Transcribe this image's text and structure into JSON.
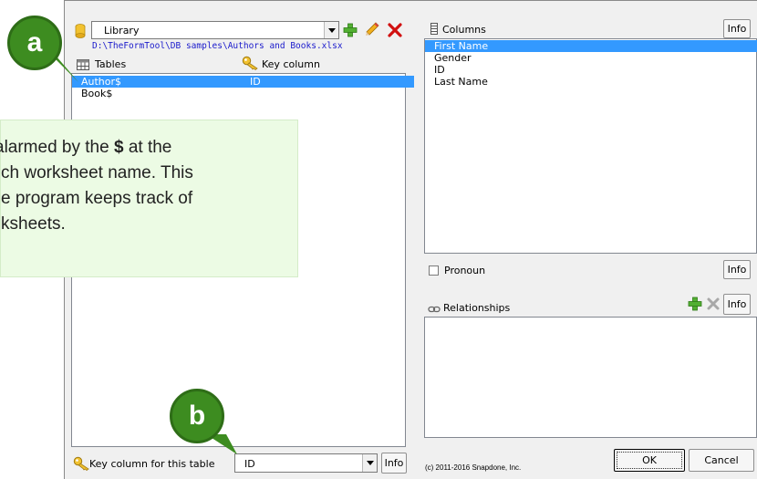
{
  "source": {
    "selected": "Library",
    "path": "D:\\TheFormTool\\DB samples\\Authors and Books.xlsx",
    "buttons": {
      "add": "+",
      "edit": "edit",
      "delete": "×"
    }
  },
  "tables": {
    "header_label": "Tables",
    "key_header_label": "Key column",
    "rows": [
      {
        "name": "Author$",
        "key": "ID",
        "selected": true
      },
      {
        "name": "Book$",
        "key": "",
        "selected": false
      }
    ]
  },
  "key_column": {
    "label": "Key column for this table",
    "value": "ID",
    "info_label": "Info"
  },
  "columns": {
    "label": "Columns",
    "info_label": "Info",
    "items": [
      {
        "name": "First Name",
        "selected": true
      },
      {
        "name": "Gender",
        "selected": false
      },
      {
        "name": "ID",
        "selected": false
      },
      {
        "name": "Last Name",
        "selected": false
      }
    ]
  },
  "pronoun": {
    "label": "Pronoun",
    "checked": false,
    "info_label": "Info"
  },
  "relationships": {
    "label": "Relationships",
    "info_label": "Info"
  },
  "footer": {
    "copyright": "(c) 2011-2016 Snapdone, Inc.",
    "ok_label": "OK",
    "cancel_label": "Cancel"
  },
  "callout": {
    "line1_pre": "alarmed by the ",
    "line1_bold": "$",
    "line1_post": " at the",
    "line2": "ch worksheet name. This",
    "line3": "e program keeps track of",
    "line4": "ksheets."
  },
  "badges": {
    "a": "a",
    "b": "b"
  },
  "colors": {
    "selection": "#3399ff",
    "badge": "#3d8c20",
    "callout_bg": "#ecfbe4",
    "path_text": "#1a1acc"
  }
}
